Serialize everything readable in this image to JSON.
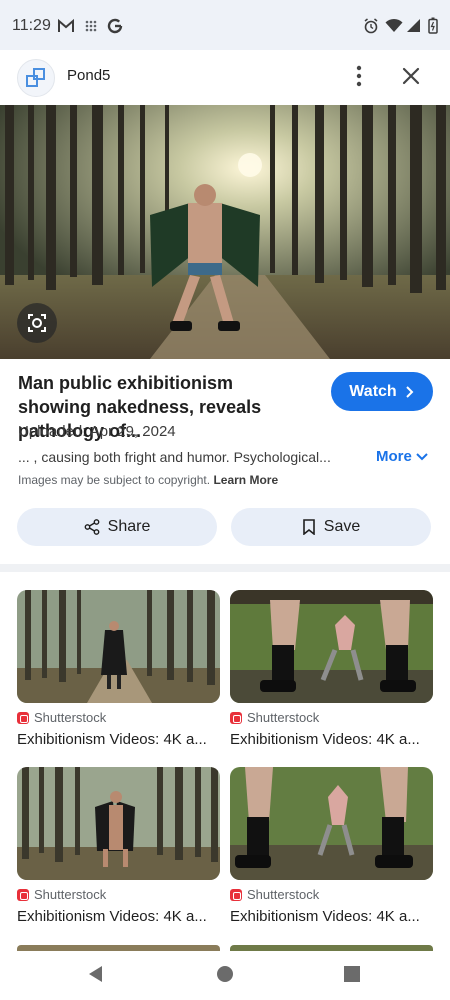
{
  "status_bar": {
    "time": "11:29",
    "left_icons": [
      "gmail-icon",
      "grid-dots-icon",
      "google-g-icon"
    ],
    "right_icons": [
      "alarm-icon",
      "wifi-icon",
      "signal-icon",
      "battery-icon"
    ]
  },
  "header": {
    "site_name": "Pond5",
    "icons": [
      "pond5-logo-icon",
      "more-vert-icon",
      "close-icon"
    ]
  },
  "result": {
    "title": "Man public exhibitionism showing nakedness, reveals pathology of...",
    "watch_label": "Watch",
    "uploaded": "Uploaded: Apr 29, 2024",
    "description": "... , causing both fright and humor. Psychological...",
    "more_label": "More",
    "copyright_text": "Images may be subject to copyright.",
    "learn_more": "Learn More",
    "share_label": "Share",
    "save_label": "Save"
  },
  "related": [
    {
      "source": "Shutterstock",
      "title": "Exhibitionism Videos: 4K a..."
    },
    {
      "source": "Shutterstock",
      "title": "Exhibitionism Videos: 4K a..."
    },
    {
      "source": "Shutterstock",
      "title": "Exhibitionism Videos: 4K a..."
    },
    {
      "source": "Shutterstock",
      "title": "Exhibitionism Videos: 4K a..."
    }
  ],
  "colors": {
    "accent": "#1a73e8",
    "status_bar_bg": "#eef2f8",
    "pill_bg": "#e8eef8",
    "source_logo": "#e8303a"
  },
  "nav": [
    "back-icon",
    "home-icon",
    "recents-icon"
  ]
}
